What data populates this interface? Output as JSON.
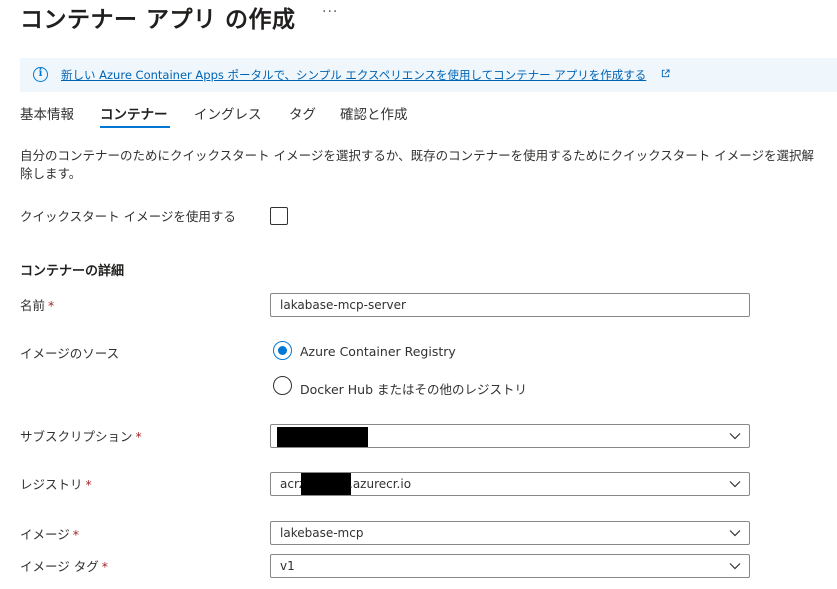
{
  "header": {
    "title": "コンテナー アプリ の作成",
    "more_label": "···"
  },
  "banner": {
    "link_text": "新しい Azure Container Apps ポータルで、シンプル エクスペリエンスを使用してコンテナー アプリを作成する",
    "info_icon": "info-icon",
    "external_icon": "external-link-icon"
  },
  "tabs": [
    {
      "label": "基本情報",
      "selected": false
    },
    {
      "label": "コンテナー",
      "selected": true
    },
    {
      "label": "イングレス",
      "selected": false
    },
    {
      "label": "タグ",
      "selected": false
    },
    {
      "label": "確認と作成",
      "selected": false
    }
  ],
  "description": "自分のコンテナーのためにクイックスタート イメージを選択するか、既存のコンテナーを使用するためにクイックスタート イメージを選択解除します。",
  "quickstart": {
    "label": "クイックスタート イメージを使用する",
    "checked": false
  },
  "details": {
    "title": "コンテナーの詳細",
    "required_mark": "*",
    "name": {
      "label": "名前",
      "value": "lakabase-mcp-server"
    },
    "image_source": {
      "label": "イメージのソース",
      "options": [
        {
          "label": "Azure Container Registry",
          "selected": true
        },
        {
          "label": "Docker Hub またはその他のレジストリ",
          "selected": false
        }
      ]
    },
    "subscription": {
      "label": "サブスクリプション",
      "value": ""
    },
    "registry": {
      "label": "レジストリ",
      "value_prefix": "acrz",
      "value_suffix": ".azurecr.io"
    },
    "image": {
      "label": "イメージ",
      "value": "lakebase-mcp"
    },
    "image_tag": {
      "label": "イメージ タグ",
      "value": "v1"
    }
  },
  "colors": {
    "accent": "#0078d4",
    "required": "#a4262c",
    "banner_bg": "#eff6fc",
    "link": "#0064b5"
  }
}
